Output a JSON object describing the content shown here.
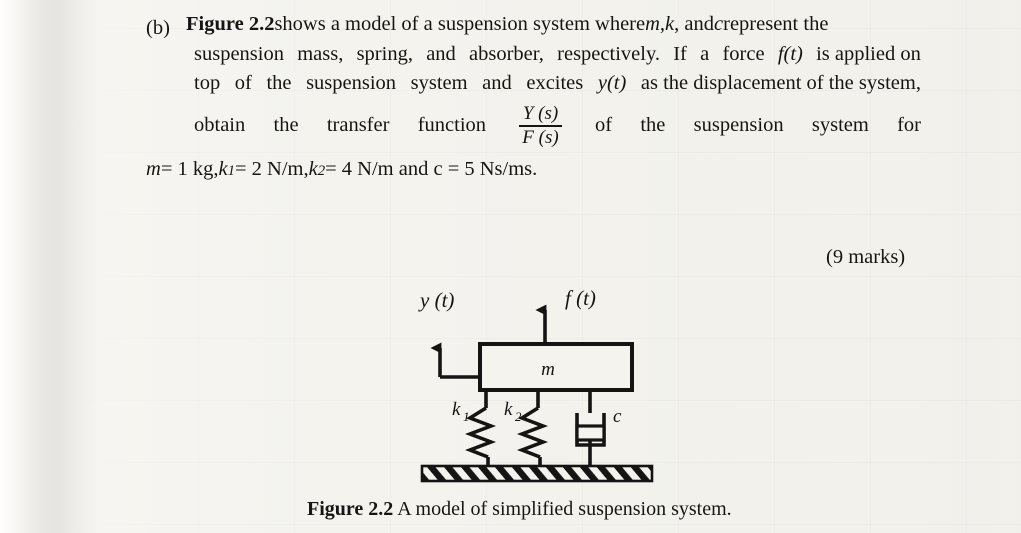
{
  "question": {
    "part_label": "(b)",
    "line1": {
      "ref_bold": "Figure 2.2",
      "text_a": " shows a model of a suspension system where ",
      "var_m": "m",
      "text_b": ", ",
      "var_k": "k",
      "text_c": ", and ",
      "var_c": "c",
      "text_d": " represent the"
    },
    "line2_words": [
      "suspension",
      "mass,",
      "spring,",
      "and",
      "absorber,",
      "respectively.",
      "If",
      "a",
      "force"
    ],
    "line2_func": "f(t)",
    "line2_tail": "is applied on",
    "line3_words": [
      "top",
      "of",
      "the",
      "suspension",
      "system",
      "and",
      "excites"
    ],
    "line3_func": "y(t)",
    "line3_tail": "as the displacement of the system,",
    "line4_words": [
      "obtain",
      "the",
      "transfer",
      "function"
    ],
    "line4_fraction": {
      "numerator": "Y (s)",
      "denominator": "F (s)"
    },
    "line4_tail_words": [
      "of",
      "the",
      "suspension",
      "system",
      "for"
    ],
    "line5": {
      "m_sym": "m",
      "m_val": " = 1 kg, ",
      "k1_sym": "k",
      "k1_sub": "1",
      "k1_val": " = 2 N/m, ",
      "k2_sym": "k",
      "k2_sub": "2",
      "k2_val": " = 4 N/m and c = 5 Ns/ms."
    },
    "marks": "(9 marks)"
  },
  "figure": {
    "label_y": "y (t)",
    "label_f": "f (t)",
    "label_mass": "m",
    "label_k1": "k",
    "label_k1_sub": "1",
    "label_k2": "k",
    "label_k2_sub": "2",
    "label_damper": "c",
    "caption_bold": "Figure 2.2",
    "caption_text": " A model of simplified suspension system.",
    "ink_color": "#141414"
  }
}
